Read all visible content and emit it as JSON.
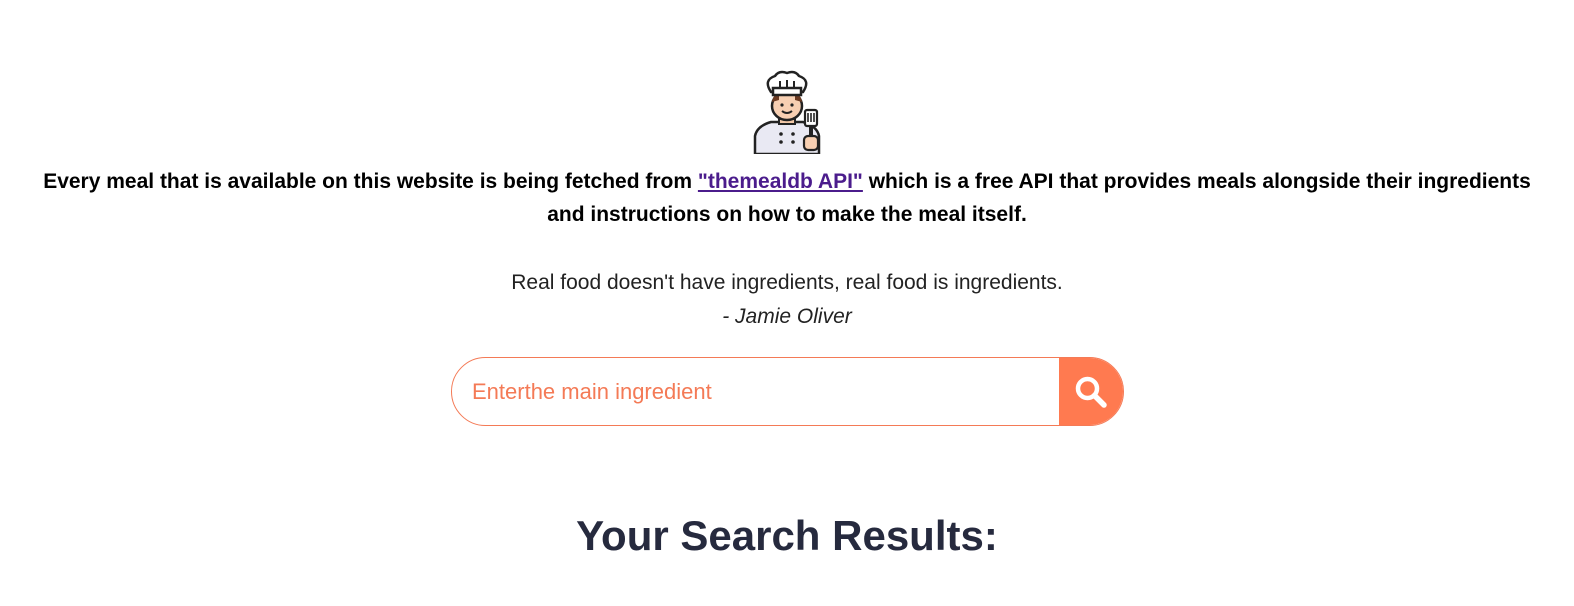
{
  "intro": {
    "prefix": "Every meal that is available on this website is being fetched from ",
    "link_text": "\"themealdb API\"",
    "suffix": " which is a free API that provides meals alongside their ingredients and instructions on how to make the meal itself."
  },
  "quote": {
    "text": "Real food doesn't have ingredients, real food is ingredients.",
    "author": "- Jamie Oliver"
  },
  "search": {
    "placeholder": "Enterthe main ingredient",
    "value": "",
    "button_icon": "search-icon"
  },
  "results": {
    "title": "Your Search Results:"
  },
  "colors": {
    "accent": "#ff7a50",
    "link": "#4b1c8c",
    "heading": "#262a3e"
  },
  "icons": {
    "logo": "chef-icon"
  }
}
